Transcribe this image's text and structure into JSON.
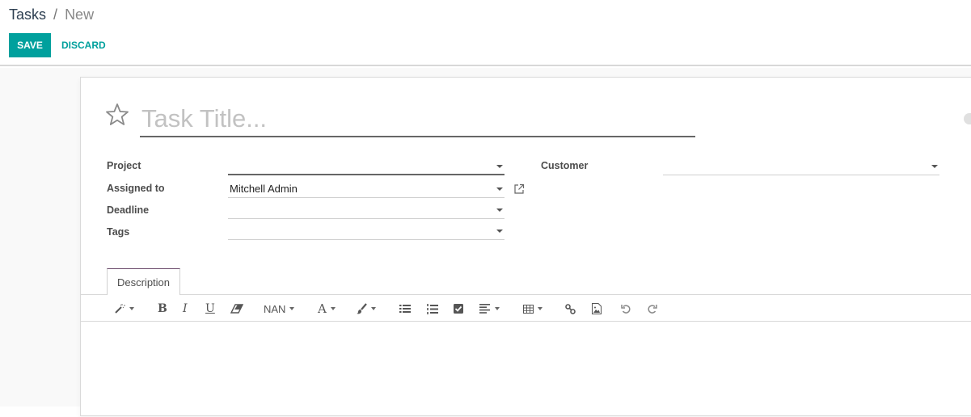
{
  "breadcrumb": {
    "parent": "Tasks",
    "separator": "/",
    "current": "New"
  },
  "actions": {
    "save_label": "SAVE",
    "discard_label": "DISCARD"
  },
  "form": {
    "title_placeholder": "Task Title...",
    "fields": {
      "project": {
        "label": "Project",
        "value": ""
      },
      "assigned_to": {
        "label": "Assigned to",
        "value": "Mitchell Admin"
      },
      "deadline": {
        "label": "Deadline",
        "value": ""
      },
      "tags": {
        "label": "Tags",
        "value": ""
      },
      "customer": {
        "label": "Customer",
        "value": ""
      }
    }
  },
  "notebook": {
    "tabs": [
      {
        "label": "Description",
        "active": true
      }
    ]
  },
  "editor_toolbar": {
    "style_icon": "magic-wand-icon",
    "bold": "B",
    "italic": "I",
    "underline": "U",
    "eraser_icon": "eraser-icon",
    "font_size": "NAN",
    "font_color": "A",
    "brush_icon": "paintbrush-icon",
    "unordered_list_icon": "list-ul-icon",
    "ordered_list_icon": "list-ol-icon",
    "checklist_icon": "checkbox-icon",
    "align_icon": "align-left-icon",
    "table_icon": "table-icon",
    "link_icon": "link-icon",
    "image_icon": "image-icon",
    "undo_icon": "undo-icon",
    "redo_icon": "redo-icon"
  },
  "colors": {
    "primary": "#00a09d",
    "tab_accent": "#6b4a6b"
  }
}
